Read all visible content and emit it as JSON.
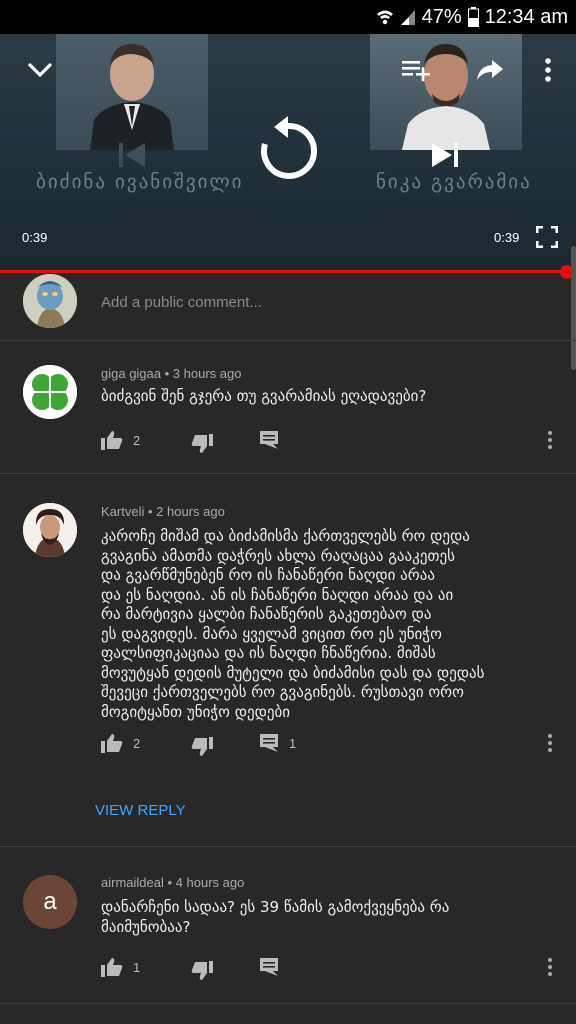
{
  "status_bar": {
    "battery": "47%",
    "time": "12:34 am",
    "icons": [
      "wifi-icon",
      "signal-icon",
      "battery-icon"
    ]
  },
  "video": {
    "caption_left": "ბიძინა  ივანიშვილი",
    "caption_right": "ნიკა  გვარამია",
    "time_elapsed": "0:39",
    "time_total": "0:39",
    "progress": 1.0,
    "controls": [
      "collapse-icon",
      "add-to-queue-icon",
      "share-icon",
      "more-icon",
      "previous-icon",
      "replay-icon",
      "next-icon",
      "fullscreen-icon"
    ]
  },
  "add_comment": {
    "placeholder": "Add a public comment..."
  },
  "comments": [
    {
      "author": "giga gigaa",
      "time": "3 hours ago",
      "text": "ბიძგვინ შენ გჯერა თუ გვარამიას ეღადავები?",
      "likes": "2",
      "replies": ""
    },
    {
      "author": "Kartveli",
      "time": "2 hours ago",
      "text": "კაროჩე მიშამ და ბიძამისმა ქართველებს რო დედა\nგვაგინა ამათმა დაჭრეს ახლა რაღაცაა გააკეთეს\nდა გვარწმუნებენ რო ის ჩანაწერი ნაღდი  არაა\nდა ეს ნაღდია. ან ის ჩანაწერი ნაღდი არაა და აი\nრა მარტივია ყალბი ჩანაწერის გაკეთებაო და\nეს დაგვიდეს. მარა ყველამ ვიცით რო ეს უნიჭო\nფალსიფიკაციაა და ის ნაღდი ჩნაწერია. მიშას\nმოვუტყან დედის მუტელი  და ბიძამისი დას და დედას\nშევეცი ქართველებს რო გვაგინებს. რუსთავი ორო\nმოგიტყანთ უნიჭო დედები",
      "likes": "2",
      "replies": "1",
      "view_reply": "VIEW REPLY"
    },
    {
      "author": "airmaildeal",
      "avatar_letter": "a",
      "time": "4 hours ago",
      "text": "დანარჩენი სადაა? ეს 39 წამის გამოქვეყნება რა\nმაიმუნობაა?",
      "likes": "1",
      "replies": ""
    }
  ],
  "colors": {
    "background": "#282828",
    "accent_red": "#e01010",
    "link_blue": "#3ea6ff",
    "avatar_brown": "#6b4536",
    "clover_green": "#3fa535"
  }
}
